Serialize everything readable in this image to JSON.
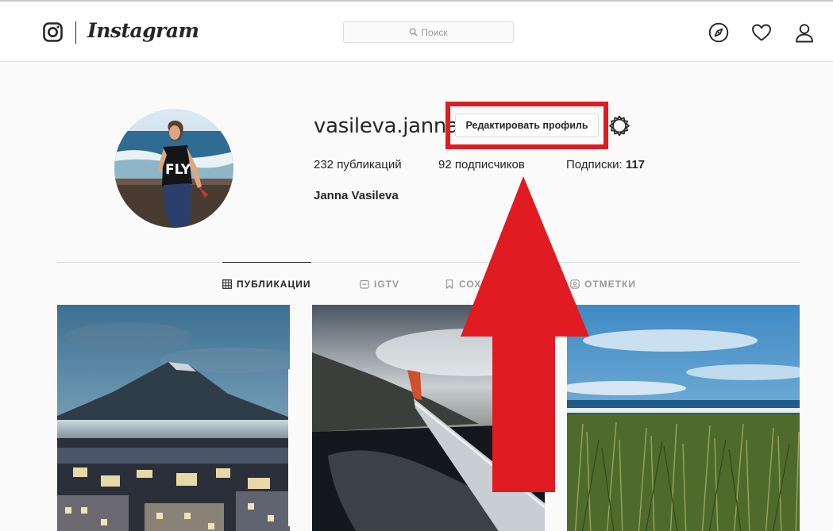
{
  "header": {
    "brand": "Instagram",
    "search_placeholder": "Поиск",
    "icons": [
      "explore-icon",
      "heart-icon",
      "profile-icon"
    ]
  },
  "profile": {
    "username": "vasileva.janna",
    "edit_button": "Редактировать профиль",
    "stats": [
      {
        "value": "232",
        "label": " публикаций"
      },
      {
        "value": "92",
        "label": " подписчиков"
      },
      {
        "label": "Подписки: ",
        "value": "117"
      }
    ],
    "full_name": "Janna Vasileva"
  },
  "tabs": [
    {
      "label": "ПУБЛИКАЦИИ",
      "icon": "grid-icon",
      "active": true
    },
    {
      "label": "IGTV",
      "icon": "igtv-icon",
      "active": false
    },
    {
      "label": "СОХРАНЕННОЕ",
      "icon": "bookmark-icon",
      "active": false
    },
    {
      "label": "ОТМЕТКИ",
      "icon": "tag-icon",
      "active": false
    }
  ],
  "posts": [
    {
      "subject": "volcano-city",
      "multi": true
    },
    {
      "subject": "airplane-window",
      "multi": false
    },
    {
      "subject": "grass-sea",
      "multi": false
    }
  ],
  "colors": {
    "annotation_red": "#e11b22",
    "border": "#dbdbdb",
    "text": "#262626",
    "muted": "#999999",
    "background": "#fafafa"
  }
}
